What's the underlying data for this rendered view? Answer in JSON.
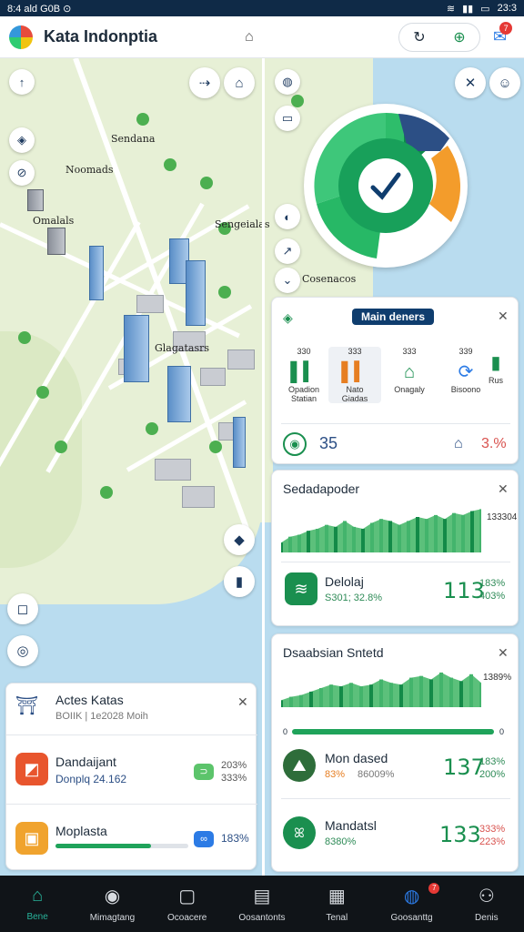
{
  "status_bar": {
    "left": "8:4 ald G0B ⊙",
    "time": "23:3"
  },
  "app": {
    "title": "Kata Indonptia"
  },
  "map_labels": [
    "Sendana",
    "Noomads",
    "Omalals",
    "Sengeialas",
    "Glagatasrs",
    "Cosenacos"
  ],
  "kpi_card": {
    "title": "Main deners",
    "stats": [
      {
        "num": "330",
        "label": "Opadion\nStatian"
      },
      {
        "num": "333",
        "label": "Nato\nGiadas"
      },
      {
        "num": "333",
        "label": "Onagaly"
      },
      {
        "num": "339",
        "label": "Bisoono"
      },
      {
        "num": "",
        "label": "Rus"
      }
    ],
    "footer_value": "35",
    "footer_pct": "3.%"
  },
  "chart_card_1": {
    "title": "Sedadapoder",
    "right_label": "133304",
    "row": {
      "label": "Delolaj",
      "sub": "S301; 32.8%",
      "value": "113",
      "pct1": "183%",
      "pct2": "403%"
    },
    "chart_data": {
      "type": "area",
      "series": [
        {
          "values": [
            5,
            8,
            9,
            11,
            12,
            14,
            13,
            16,
            13,
            12,
            15,
            17,
            16,
            14,
            16,
            18,
            17,
            19,
            17,
            20,
            19,
            21,
            22
          ]
        }
      ]
    }
  },
  "chart_card_2": {
    "title": "Dsaabsian Sntetd",
    "right_label": "1389%",
    "rows": [
      {
        "label": "Mon dased",
        "sub_a": "83%",
        "sub_b": "86009%",
        "value": "137",
        "pct1": "183%",
        "pct2": "200%"
      },
      {
        "label": "Mandatsl",
        "sub_a": "8380%",
        "sub_b": "",
        "value": "133",
        "pct1": "333%",
        "pct2": "223%"
      }
    ],
    "chart_data": {
      "type": "area",
      "series": [
        {
          "values": [
            4,
            6,
            7,
            9,
            11,
            13,
            12,
            14,
            12,
            13,
            16,
            14,
            13,
            17,
            18,
            16,
            20,
            17,
            15,
            19,
            14
          ]
        }
      ]
    },
    "progress_ticks": [
      "0",
      "0"
    ]
  },
  "left_panel": {
    "title": "Actes Katas",
    "subtitle": "BOIIK | 1e2028 Moih",
    "rows": [
      {
        "label": "Dandaijant",
        "sub": "Donplq 24.162",
        "pct1": "203%",
        "pct2": "333%"
      },
      {
        "label": "Moplasta",
        "pct": "183%",
        "progress": 0.72
      }
    ]
  },
  "bottom_nav": [
    {
      "label": "Bene",
      "icon": "home-icon"
    },
    {
      "label": "Mimagtang",
      "icon": "compass-icon"
    },
    {
      "label": "Ocoacere",
      "icon": "window-icon"
    },
    {
      "label": "Oosantonts",
      "icon": "wallet-icon"
    },
    {
      "label": "Tenal",
      "icon": "clipboard-icon"
    },
    {
      "label": "Goosanttg",
      "icon": "globe-icon",
      "badge": "7"
    },
    {
      "label": "Denis",
      "icon": "people-icon"
    }
  ],
  "colors": {
    "accent_green": "#1a8f4f",
    "navy": "#0f3d6e",
    "water": "#b9dcef",
    "land": "#e7f0d6"
  }
}
